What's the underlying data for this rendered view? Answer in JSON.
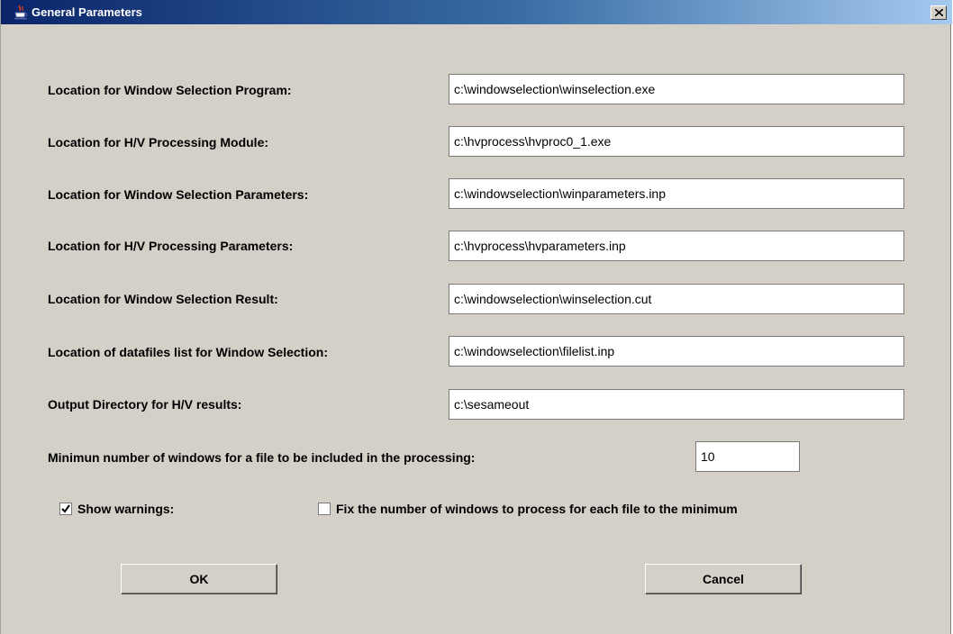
{
  "window": {
    "title": "General Parameters",
    "app_icon": "java-cup-icon",
    "close_icon": "close-icon"
  },
  "fields": [
    {
      "label": "Location for Window Selection Program:",
      "value": "c:\\windowselection\\winselection.exe"
    },
    {
      "label": "Location for H/V Processing Module:",
      "value": "c:\\hvprocess\\hvproc0_1.exe"
    },
    {
      "label": "Location for Window Selection Parameters:",
      "value": "c:\\windowselection\\winparameters.inp"
    },
    {
      "label": "Location for H/V Processing Parameters:",
      "value": "c:\\hvprocess\\hvparameters.inp"
    },
    {
      "label": "Location for Window Selection Result:",
      "value": "c:\\windowselection\\winselection.cut"
    },
    {
      "label": "Location of datafiles list for Window Selection:",
      "value": "c:\\windowselection\\filelist.inp"
    },
    {
      "label": "Output Directory for H/V results:",
      "value": "c:\\sesameout"
    }
  ],
  "min_windows": {
    "label": "Minimun number of windows for a file to be included in the processing:",
    "value": "10"
  },
  "checkboxes": {
    "show_warnings": {
      "label": "Show warnings:",
      "checked": true
    },
    "fix_windows": {
      "label": "Fix the number of windows to process for each file to the minimum",
      "checked": false
    }
  },
  "buttons": {
    "ok": "OK",
    "cancel": "Cancel"
  },
  "colors": {
    "dialog_bg": "#d4d0c8",
    "title_gradient_start": "#0a246a",
    "title_gradient_end": "#a6caf0"
  }
}
